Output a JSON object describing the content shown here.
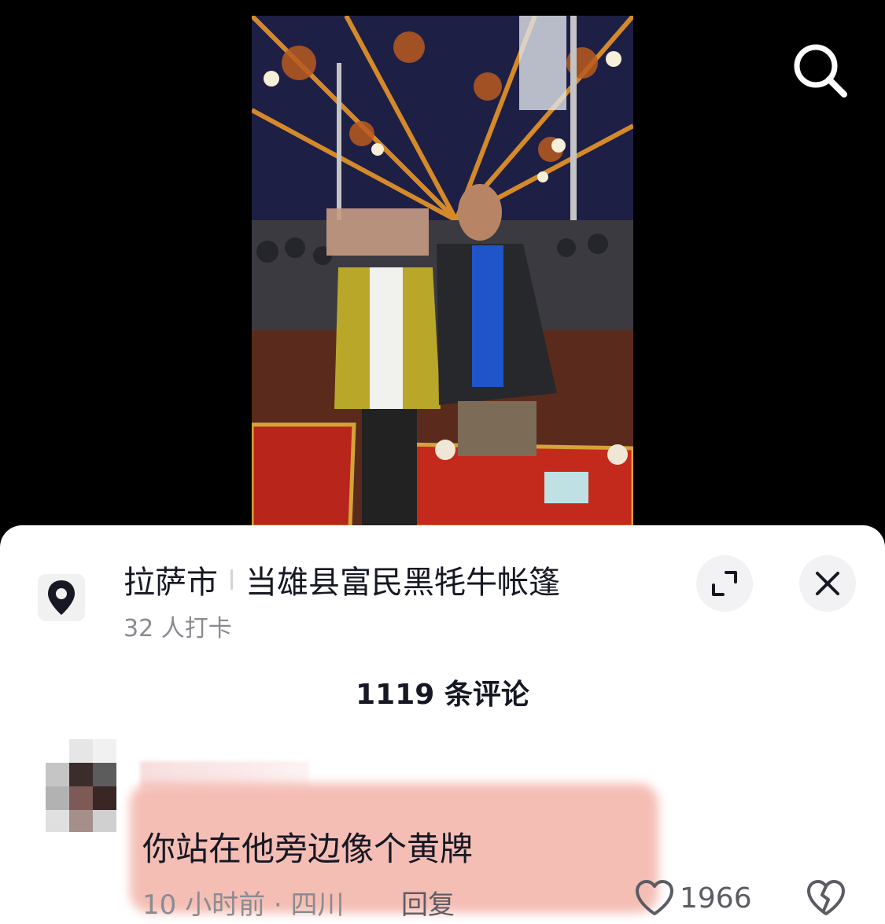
{
  "location": {
    "city": "拉萨市",
    "name": "当雄县富民黑牦牛帐篷",
    "checkins": "32 人打卡"
  },
  "comments": {
    "count_label": "1119 条评论",
    "items": [
      {
        "text": "你站在他旁边像个黄牌",
        "time_region": "10 小时前 · 四川",
        "reply_label": "回复",
        "likes": "1966"
      }
    ]
  },
  "icons": {
    "search": "search-icon",
    "location": "location-pin-icon",
    "expand": "expand-icon",
    "close": "close-icon",
    "like": "heart-outline-icon",
    "dislike": "broken-heart-icon"
  },
  "colors": {
    "sheet_bg": "#ffffff",
    "text_primary": "#161823",
    "text_secondary": "#8a8b91",
    "button_bg": "#f2f2f4",
    "comment_highlight": "#f3b3a9"
  }
}
